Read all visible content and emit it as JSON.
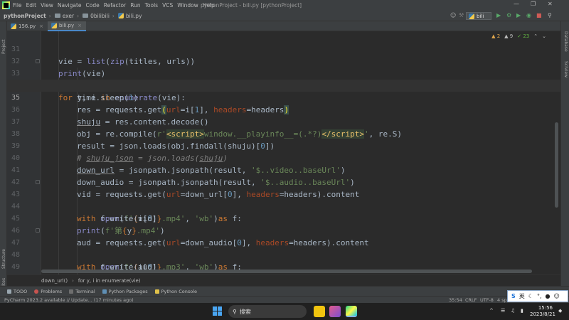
{
  "titlebar": {
    "menu": [
      "File",
      "Edit",
      "View",
      "Navigate",
      "Code",
      "Refactor",
      "Run",
      "Tools",
      "VCS",
      "Window",
      "Help"
    ],
    "window_title": "pythonProject - bili.py [pythonProject]"
  },
  "navbar": {
    "crumbs": [
      "pythonProject",
      "exer",
      "0bilibili",
      "bili.py"
    ],
    "run_config": "bili"
  },
  "left_strip": {
    "project": "Project",
    "structure": "Structure",
    "favorites": "Favorites"
  },
  "right_strip": {
    "database": "Database",
    "sciview": "SciView"
  },
  "tabs": [
    {
      "label": "156.py",
      "active": false
    },
    {
      "label": "bili.py",
      "active": true
    }
  ],
  "inspections": {
    "warnings": "2",
    "weak_warnings": "9",
    "typos": "23"
  },
  "editor": {
    "current_line": "35",
    "line_numbers": [
      "31",
      "32",
      "33",
      "34",
      "35",
      "36",
      "37",
      "38",
      "39",
      "40",
      "41",
      "42",
      "43",
      "44",
      "45",
      "46",
      "47",
      "48",
      "49",
      "50"
    ]
  },
  "breadcrumb": [
    "down_url()",
    "for y, i in enumerate(vie)"
  ],
  "tool_windows": [
    "TODO",
    "Problems",
    "Terminal",
    "Python Packages",
    "Python Console"
  ],
  "status": {
    "message": "PyCharm 2023.2 available // Update... (17 minutes ago)",
    "position": "35:54",
    "line_sep": "CRLF",
    "encoding": "UTF-8",
    "indent": "4 sp"
  },
  "ime": {
    "lang": "英"
  },
  "taskbar": {
    "search_label": "搜索",
    "time": "15:56",
    "date": "2023/8/21",
    "tray_chevron": "^"
  },
  "colors": {
    "keyword": "#cc7832",
    "string": "#6a8759",
    "number": "#6897bb",
    "kwarg": "#aa4926",
    "comment": "#808080",
    "editor_bg": "#2b2b2b"
  }
}
